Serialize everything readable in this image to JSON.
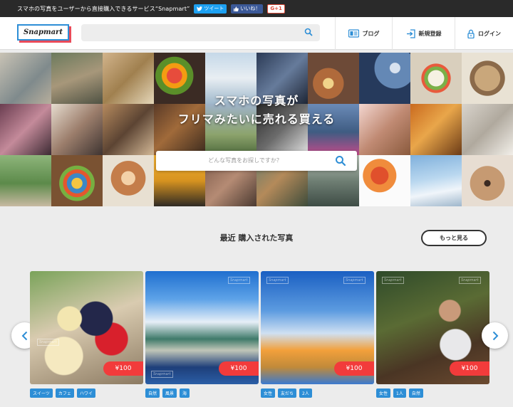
{
  "topbar": {
    "message": "スマホの写真をユーザーから直接購入できるサービス“Snapmart”",
    "tweet": "ツイート",
    "like": "いいね！",
    "gplus": "G+1"
  },
  "header": {
    "logo": "Snapmart",
    "search_placeholder": "",
    "nav": {
      "blog": "ブログ",
      "signup": "新規登録",
      "login": "ログイン"
    }
  },
  "hero": {
    "title_line1": "スマホの写真が",
    "title_line2": "フリマみたいに売れる買える",
    "search_placeholder": "どんな写真をお探しですか？"
  },
  "recent": {
    "title": "最近 購入された写真",
    "more": "もっと見る",
    "cards": [
      {
        "price": "¥100",
        "watermark": "Snapmart",
        "tags": [
          "スイーツ",
          "カフェ",
          "ハワイ"
        ]
      },
      {
        "price": "¥100",
        "watermark": "Snapmart",
        "tags": [
          "自然",
          "風景",
          "海"
        ]
      },
      {
        "price": "¥100",
        "watermark": "Snapmart",
        "tags": [
          "女性",
          "友だち",
          "2人"
        ]
      },
      {
        "price": "¥100",
        "watermark": "Snapmart",
        "tags": [
          "女性",
          "1人",
          "自然"
        ]
      }
    ]
  },
  "colors": {
    "accent": "#2d8ed6",
    "price": "#f23b3b",
    "logo_shadow": "#e94b5a"
  }
}
